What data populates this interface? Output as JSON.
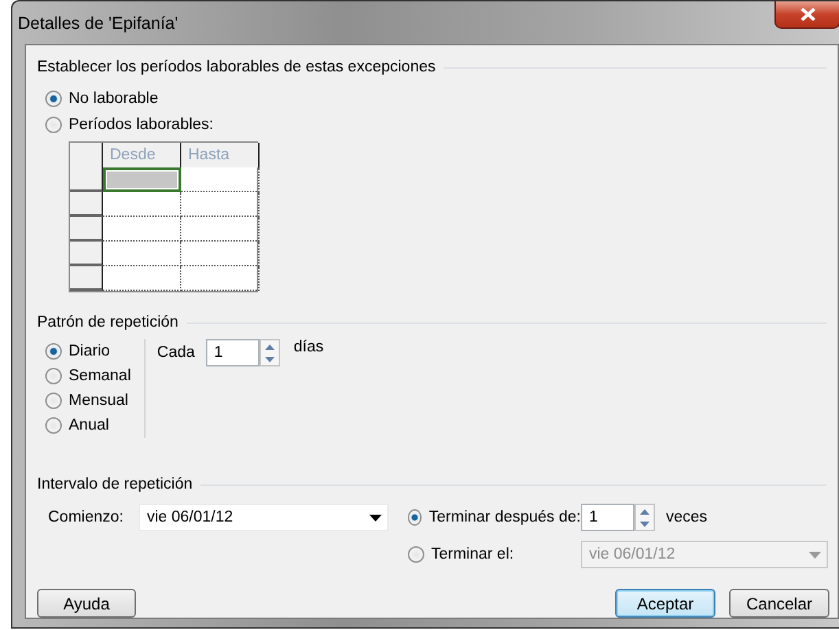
{
  "window": {
    "title": "Detalles de 'Epifanía'"
  },
  "exceptions": {
    "title": "Establecer los períodos laborables de estas excepciones",
    "options": [
      {
        "label": "No laborable",
        "selected": true
      },
      {
        "label": "Períodos laborables:",
        "selected": false
      }
    ],
    "grid": {
      "disabled": true,
      "columns": [
        "Desde",
        "Hasta"
      ],
      "rows": [
        {
          "selected": true
        },
        {
          "selected": false
        },
        {
          "selected": false
        },
        {
          "selected": false
        },
        {
          "selected": false
        }
      ]
    }
  },
  "pattern": {
    "title": "Patrón de repetición",
    "options": [
      {
        "label": "Diario",
        "selected": true
      },
      {
        "label": "Semanal",
        "selected": false
      },
      {
        "label": "Mensual",
        "selected": false
      },
      {
        "label": "Anual",
        "selected": false
      }
    ],
    "every_label": "Cada",
    "every_value": "1",
    "every_unit": "días"
  },
  "range": {
    "title": "Intervalo de repetición",
    "start_label": "Comienzo:",
    "start_value": "vie 06/01/12",
    "end_options": [
      {
        "kind": "count",
        "label": "Terminar después de:",
        "selected": true,
        "value": "1",
        "unit": "veces",
        "disabled": false
      },
      {
        "kind": "date",
        "label": "Terminar el:",
        "selected": false,
        "value": "vie 06/01/12",
        "disabled": true
      }
    ]
  },
  "buttons": [
    {
      "label": "Ayuda",
      "default": false
    },
    {
      "label": "Aceptar",
      "default": true
    },
    {
      "label": "Cancelar",
      "default": false
    }
  ]
}
